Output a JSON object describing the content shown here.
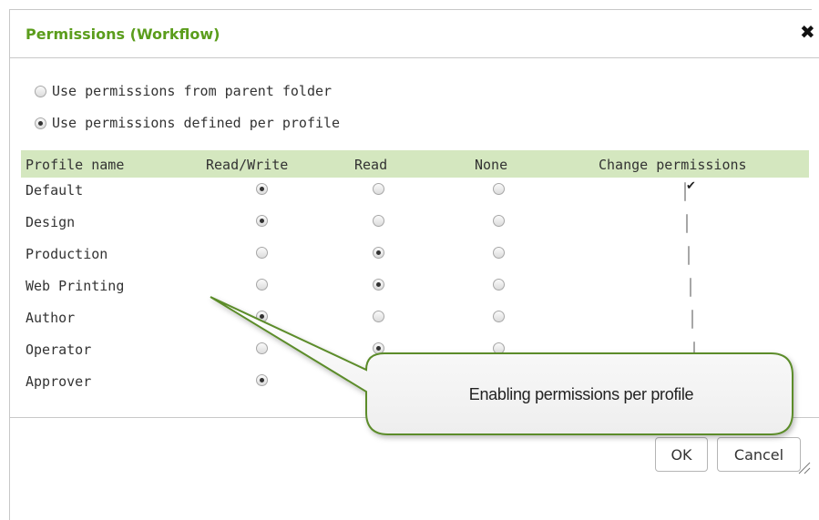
{
  "dialog": {
    "title": "Permissions (Workflow)",
    "close_icon": "close-icon"
  },
  "options": [
    {
      "label": "Use permissions from parent folder",
      "selected": false
    },
    {
      "label": "Use permissions defined per profile",
      "selected": true
    }
  ],
  "table": {
    "headers": [
      "Profile name",
      "Read/Write",
      "Read",
      "None",
      "Change permissions"
    ],
    "rows": [
      {
        "name": "Default",
        "access": "Read/Write",
        "change": true
      },
      {
        "name": "Design",
        "access": "Read/Write",
        "change": false
      },
      {
        "name": "Production",
        "access": "Read",
        "change": false
      },
      {
        "name": "Web Printing",
        "access": "Read",
        "change": false
      },
      {
        "name": "Author",
        "access": "Read/Write",
        "change": false
      },
      {
        "name": "Operator",
        "access": "Read",
        "change": false
      },
      {
        "name": "Approver",
        "access": "Read/Write",
        "change": false
      }
    ]
  },
  "callout": {
    "text": "Enabling permissions per profile"
  },
  "buttons": {
    "ok": "OK",
    "cancel": "Cancel"
  },
  "colors": {
    "title": "#5b9d1c",
    "header_bg": "#d4e7bf",
    "callout_border": "#5b8c2a"
  }
}
